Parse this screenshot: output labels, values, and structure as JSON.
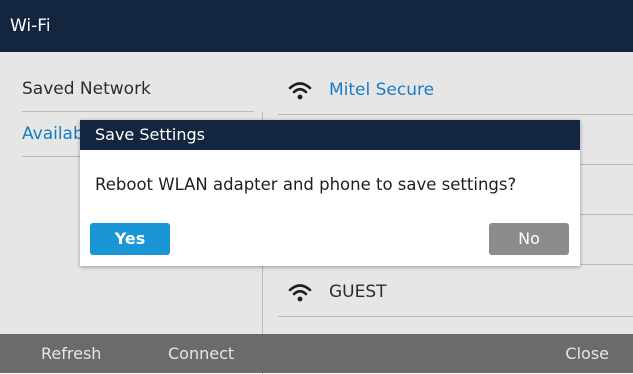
{
  "window": {
    "title": "Wi-Fi"
  },
  "left_menu": {
    "items": [
      {
        "label": "Saved Network"
      },
      {
        "label": "Available Networks"
      }
    ]
  },
  "networks": [
    {
      "name": "Mitel Secure",
      "icon": "wifi-icon"
    },
    {
      "name": "",
      "icon": "wifi-icon"
    },
    {
      "name": "",
      "icon": "wifi-icon"
    },
    {
      "name": "",
      "icon": "wifi-icon"
    },
    {
      "name": "GUEST",
      "icon": "wifi-icon"
    }
  ],
  "dialog": {
    "title": "Save Settings",
    "message": "Reboot WLAN adapter and phone to save settings?",
    "yes_label": "Yes",
    "no_label": "No"
  },
  "softkeys": {
    "refresh": "Refresh",
    "connect": "Connect",
    "close": "Close"
  },
  "colors": {
    "title_bar": "#142540",
    "accent_blue": "#1b7cc1",
    "yes_button": "#1a96d6",
    "no_button": "#8c8c8c",
    "softkey_bar": "#6b6b6b",
    "panel_bg": "#e6e6e6"
  }
}
